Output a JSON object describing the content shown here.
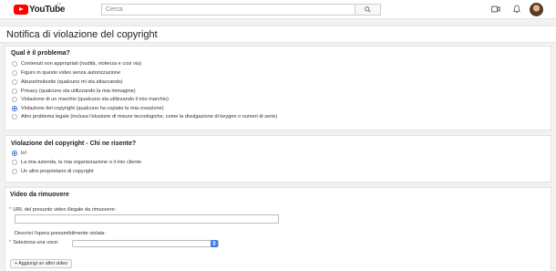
{
  "header": {
    "logo_text": "YouTube",
    "logo_region": "IT",
    "search_placeholder": "Cerca",
    "icons": [
      "search-icon",
      "video-camera-icon",
      "bell-icon",
      "avatar"
    ]
  },
  "page": {
    "title": "Notifica di violazione del copyright"
  },
  "problem_section": {
    "title": "Qual è il problema?",
    "options": [
      "Contenuti non appropriati (nudità, violenza e così via)",
      "Figuro in questo video senza autorizzazione",
      "Abuso/molestie (qualcuno mi sta attaccando)",
      "Privacy (qualcuno sta utilizzando la mia immagine)",
      "Violazione di un marchio (qualcuno sta utilizzando il mio marchio)",
      "Violazione del copyright (qualcuno ha copiato la mia creazione)",
      "Altro problema legale (inclusa l'elusione di misure tecnologiche, come la divulgazione di keygen o numeri di serie)"
    ],
    "selected_index": 5
  },
  "victim_section": {
    "title": "Violazione del copyright - Chi ne risente?",
    "options": [
      "Io!",
      "La mia azienda, la mia organizzazione o il mio cliente",
      "Un altro proprietario di copyright"
    ],
    "selected_index": 0
  },
  "video_section": {
    "title": "Video da rimuovere",
    "url_label": "URL del presunto video illegale da rimuovere:",
    "url_value": "",
    "describe_label": "Descrivi l'opera presumibilmente violata:",
    "select_label": "Seleziona una voce:",
    "select_value": "",
    "add_button": "+ Aggiungi un altro video"
  },
  "colors": {
    "brand_red": "#ff0000",
    "accent_blue": "#2d6fdb",
    "required_red": "#dd3333"
  }
}
